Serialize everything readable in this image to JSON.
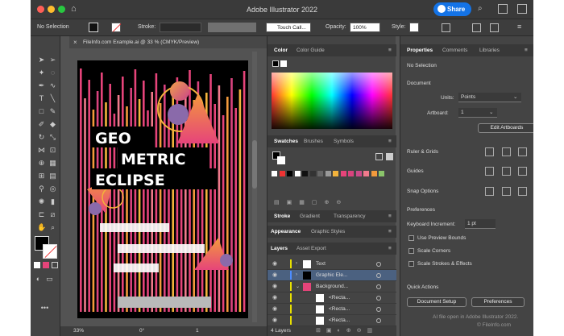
{
  "app": {
    "title": "Adobe Illustrator 2022",
    "share_label": "Share"
  },
  "control_bar": {
    "selection": "No Selection",
    "stroke_label": "Stroke:",
    "brush_value": "Touch Call...",
    "opacity_label": "Opacity:",
    "opacity_value": "100%",
    "style_label": "Style:"
  },
  "document_tab": {
    "label": "FileInfo.com Example.ai @ 33 % (CMYK/Preview)"
  },
  "artwork": {
    "line1": "GEO",
    "line2": "METRIC",
    "line3": "ECLIPSE"
  },
  "status_bar": {
    "zoom": "33%",
    "rotation": "0°",
    "artboard": "1"
  },
  "color_panel": {
    "tabs": [
      "Color",
      "Color Guide"
    ]
  },
  "swatches_panel": {
    "tabs": [
      "Swatches",
      "Brushes",
      "Symbols"
    ]
  },
  "stroke_panel": {
    "tabs": [
      "Stroke",
      "Gradient",
      "Transparency"
    ]
  },
  "appearance_panel": {
    "tabs": [
      "Appearance",
      "Graphic Styles"
    ]
  },
  "layers_panel": {
    "tabs": [
      "Layers",
      "Asset Export"
    ],
    "count": "4 Layers",
    "rows": [
      {
        "label": "Text"
      },
      {
        "label": "Graphic Ele..."
      },
      {
        "label": "Background..."
      },
      {
        "label": "<Recta..."
      },
      {
        "label": "<Recta..."
      },
      {
        "label": "<Recta..."
      }
    ]
  },
  "properties_panel": {
    "tabs": [
      "Properties",
      "Comments",
      "Libraries"
    ],
    "selection": "No Selection",
    "document_header": "Document",
    "units_label": "Units:",
    "units_value": "Points",
    "artboard_label": "Artboard:",
    "artboard_value": "1",
    "edit_artboards": "Edit Artboards",
    "ruler_grids": "Ruler & Grids",
    "guides": "Guides",
    "snap_options": "Snap Options",
    "preferences_header": "Preferences",
    "keyboard_increment_label": "Keyboard Increment:",
    "keyboard_increment_value": "1 pt",
    "use_preview_bounds": "Use Preview Bounds",
    "scale_corners": "Scale Corners",
    "scale_strokes": "Scale Strokes & Effects",
    "quick_actions": "Quick Actions",
    "document_setup": "Document Setup",
    "preferences_button": "Preferences"
  },
  "watermark": {
    "line1": "AI file open in Adobe Illustrator 2022.",
    "line2": "© FileInfo.com"
  },
  "colors": {
    "accent": "#1473e6",
    "pink": "#e6447a",
    "orange": "#f39a3c",
    "black": "#000000"
  }
}
